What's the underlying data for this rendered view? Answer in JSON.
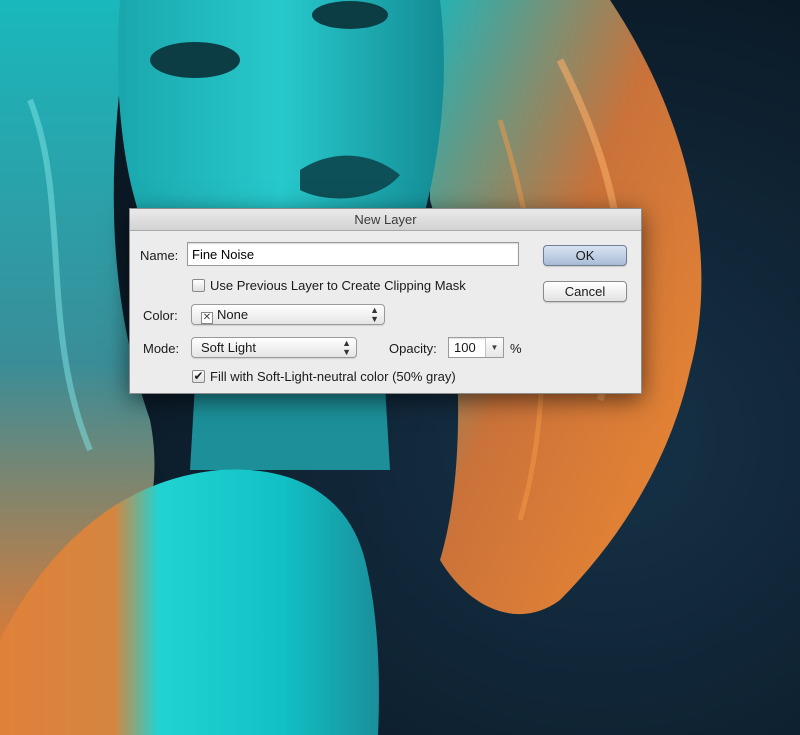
{
  "dialog": {
    "title": "New Layer",
    "name_label": "Name:",
    "name_value": "Fine Noise",
    "clipping_mask_label": "Use Previous Layer to Create Clipping Mask",
    "clipping_mask_checked": false,
    "color_label": "Color:",
    "color_value": "None",
    "mode_label": "Mode:",
    "mode_value": "Soft Light",
    "opacity_label": "Opacity:",
    "opacity_value": "100",
    "opacity_unit": "%",
    "fill_label": "Fill with Soft-Light-neutral color (50% gray)",
    "fill_checked": true,
    "ok_label": "OK",
    "cancel_label": "Cancel",
    "checkmark": "✔",
    "swatch_x": "✕",
    "arrow_up": "▲",
    "arrow_down": "▼"
  },
  "colors": {
    "background_dark": "#0f2233",
    "teal": "#17c7c9",
    "orange": "#e8752a"
  }
}
